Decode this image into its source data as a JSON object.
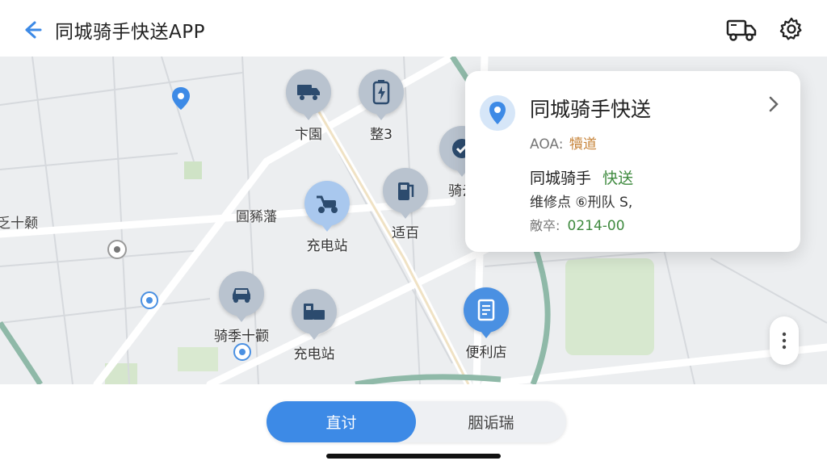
{
  "header": {
    "title": "同城骑手快送APP",
    "back_icon": "back-arrow-icon",
    "actions": [
      "truck-icon",
      "gear-icon"
    ]
  },
  "map": {
    "pois": [
      {
        "id": "poi-truck",
        "icon": "truck-icon",
        "label": "卞園"
      },
      {
        "id": "poi-battery",
        "icon": "battery-charge-icon",
        "label": "整3"
      },
      {
        "id": "poi-check",
        "icon": "check-icon",
        "label": "骑云"
      },
      {
        "id": "poi-scooter",
        "icon": "scooter-icon",
        "label": "充电站"
      },
      {
        "id": "poi-fuel",
        "icon": "fuel-pump-icon",
        "label": "适百"
      },
      {
        "id": "poi-car",
        "icon": "car-icon",
        "label": "骑季十颧"
      },
      {
        "id": "poi-machine",
        "icon": "machine-icon",
        "label": "充电站"
      },
      {
        "id": "poi-store",
        "icon": "store-receipt-icon",
        "label": "便利店"
      }
    ],
    "area_labels": [
      "乏十颡",
      "圓豨藩"
    ]
  },
  "card": {
    "title": "同城骑手快送",
    "sub_prefix": "AOA:",
    "sub_tag": "犢道",
    "rider_label": "同城骑手",
    "rider_status": "快送",
    "repair": "维修点 ⑥刑队 S,",
    "distance_label": "敵卒:",
    "distance_value": "0214-00"
  },
  "bottom": {
    "tab_active": "直讨",
    "tab_inactive": "胭诟瑞"
  },
  "colors": {
    "accent": "#3d8ae6",
    "green": "#3f8a3f",
    "orange": "#c7843a",
    "river": "#8fb9a8",
    "park": "#cfe3c6"
  }
}
